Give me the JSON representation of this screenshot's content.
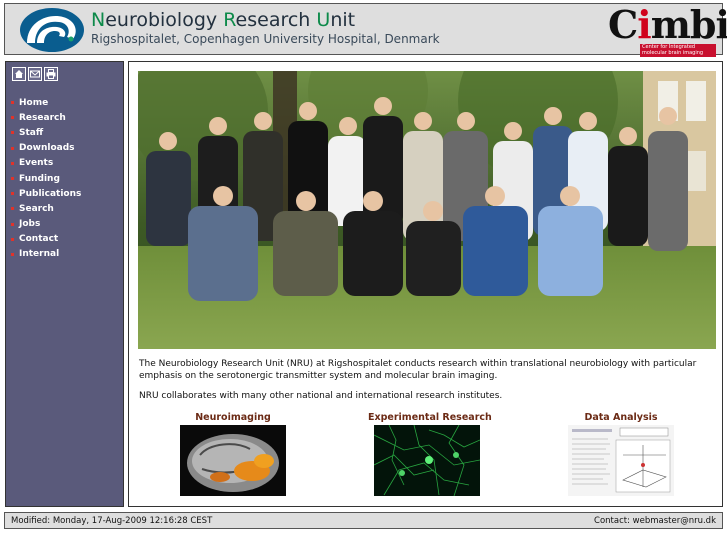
{
  "header": {
    "title_parts": [
      "N",
      "eurobiology ",
      "R",
      "esearch ",
      "U",
      "nit"
    ],
    "subtitle": "Rigshospitalet, Copenhagen University Hospital, Denmark",
    "partner_logo": {
      "text_c": "C",
      "text_i": "i",
      "text_mbi": "mbi",
      "tagline_1": "Center for Integrated",
      "tagline_2": "molecular brain imaging"
    }
  },
  "sidebar": {
    "icons": [
      "home-icon",
      "mail-icon",
      "print-icon"
    ],
    "items": [
      {
        "label": "Home"
      },
      {
        "label": "Research"
      },
      {
        "label": "Staff"
      },
      {
        "label": "Downloads"
      },
      {
        "label": "Events"
      },
      {
        "label": "Funding"
      },
      {
        "label": "Publications"
      },
      {
        "label": "Search"
      },
      {
        "label": "Jobs"
      },
      {
        "label": "Contact"
      },
      {
        "label": "Internal"
      }
    ]
  },
  "main": {
    "intro": "The Neurobiology Research Unit (NRU) at Rigshospitalet conducts research within translational neurobiology with particular emphasis on the serotonergic transmitter system and molecular brain imaging.",
    "collab": "NRU collaborates with many other national and international research institutes.",
    "features": [
      {
        "title": "Neuroimaging"
      },
      {
        "title": "Experimental Research"
      },
      {
        "title": "Data Analysis"
      }
    ]
  },
  "footer": {
    "modified": "Modified: Monday, 17-Aug-2009 12:16:28 CEST",
    "contact": "Contact: webmaster@nru.dk"
  },
  "colors": {
    "accent_green": "#0d8a4a",
    "sidebar_bg": "#5a5a7b",
    "nav_bullet": "#e0332a",
    "feature_title": "#6b2a15"
  }
}
